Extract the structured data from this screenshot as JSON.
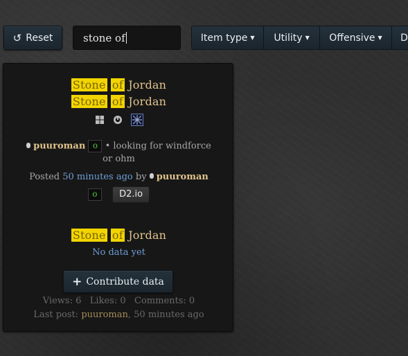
{
  "toolbar": {
    "reset_icon": "undo-icon",
    "reset_label": "Reset",
    "search_value": "stone of",
    "filters": [
      {
        "label": "Item type"
      },
      {
        "label": "Utility"
      },
      {
        "label": "Offensive"
      },
      {
        "label": "D"
      }
    ]
  },
  "listing": {
    "have_title": {
      "hl1": "Stone",
      "hl2": "of",
      "rest": "Jordan"
    },
    "want_title": {
      "hl1": "Stone",
      "hl2": "of",
      "rest": "Jordan"
    },
    "platforms": [
      "windows-icon",
      "playstation-icon",
      "switch-icon"
    ],
    "author": "puuroman",
    "rune_badge": "o",
    "note_line1": "• looking for windforce",
    "note_line2": "or ohm",
    "posted_prefix": "Posted",
    "posted_time": "50 minutes ago",
    "posted_by": "by",
    "posted_user": "puuroman",
    "posted_badge": "o",
    "d2io_label": "D2.io",
    "price_title": {
      "hl1": "Stone",
      "hl2": "of",
      "rest": "Jordan"
    },
    "price_status": "No data yet",
    "contribute_label": "Contribute data",
    "stats": {
      "views": "Views: 6",
      "likes": "Likes: 0",
      "comments": "Comments: 0",
      "last_post_prefix": "Last post:",
      "last_post_user": "puuroman",
      "last_post_time": ", 50 minutes ago"
    }
  },
  "colors": {
    "highlight": "#f2d500",
    "item_name": "#e1c48c",
    "link": "#6f9fd8",
    "rune_green": "#4fc83b"
  }
}
